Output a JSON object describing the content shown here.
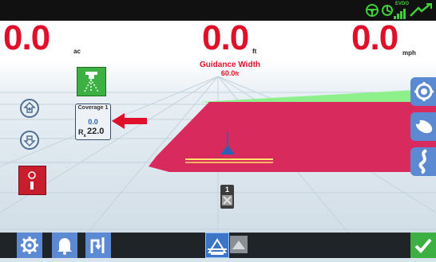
{
  "status_bar": {
    "network_label": "EVDO",
    "icons": [
      "steering-wheel-icon",
      "gps-icon",
      "signal-bars-icon",
      "wrench-check-icon"
    ]
  },
  "header": {
    "area": {
      "value": "0.0",
      "unit": "ac"
    },
    "distance": {
      "value": "0.0",
      "unit": "ft"
    },
    "speed": {
      "value": "0.0",
      "unit": "mph"
    }
  },
  "guidance": {
    "title": "Guidance Width",
    "value": "60.0",
    "unit": "ft"
  },
  "coverage": {
    "title": "Coverage 1",
    "value": "0.0",
    "rx_label": "R",
    "rx_sub": "x",
    "rate": "22.0"
  },
  "section_indicator": {
    "number": "1"
  },
  "colors": {
    "readout_red": "#e0102a",
    "coverage_magenta": "#d92a5e",
    "boundary_green": "#8ef08a",
    "side_tab_blue": "#5b8ad3",
    "bottom_bar": "#1f2428",
    "accept_green": "#3cb043"
  },
  "bottom_bar": {
    "left_icons": [
      "settings-gear-icon",
      "alarm-bell-icon",
      "uturn-icon"
    ],
    "center_icons": [
      "guidance-view-icon",
      "field-view-icon"
    ],
    "right_icons": [
      "accept-check-icon"
    ]
  },
  "side_tabs": [
    "settings-gear-tab-icon",
    "spray-tab-icon",
    "steering-tab-icon"
  ]
}
